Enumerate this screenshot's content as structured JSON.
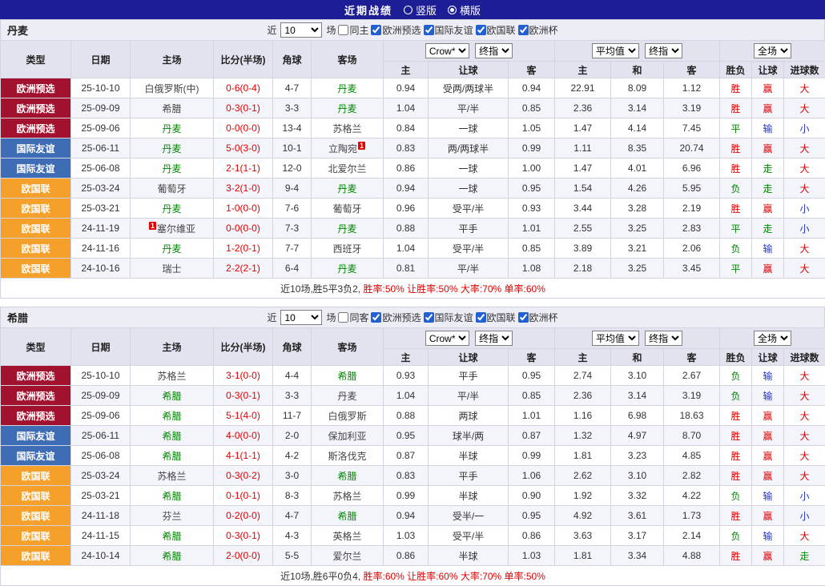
{
  "page": {
    "title": "近期战绩",
    "view_options": [
      {
        "label": "竖版",
        "selected": false
      },
      {
        "label": "横版",
        "selected": true
      }
    ]
  },
  "colors": {
    "titlebar": "#1d1d96",
    "type_colors": {
      "欧洲预选": "#a2112e",
      "国际友谊": "#3e6cb5",
      "欧国联": "#f5a02a"
    },
    "focal_team": "#008800",
    "opponent_team": "#444444",
    "score": "#dd0000",
    "result_map": {
      "胜": "#dd0000",
      "平": "#008800",
      "负": "#008800",
      "赢": "#dd0000",
      "输": "#2233cc",
      "走": "#008800",
      "大": "#dd0000",
      "小": "#2233cc"
    }
  },
  "table": {
    "columns_row1": [
      "类型",
      "日期",
      "主场",
      "比分(半场)",
      "角球",
      "客场"
    ],
    "columns_row2": [
      "主",
      "让球",
      "客",
      "主",
      "和",
      "客",
      "胜负",
      "让球",
      "进球数"
    ],
    "selects": {
      "odds_source": "Crow*",
      "odds_final_1": "终指",
      "avg_source": "平均值",
      "odds_final_2": "终指",
      "scope": "全场"
    }
  },
  "sections": [
    {
      "team": "丹麦",
      "filters": {
        "recent_label": "近",
        "count": "10",
        "games_label": "场",
        "same_venue": {
          "label": "同主",
          "checked": false
        },
        "competitions": [
          {
            "label": "欧洲预选",
            "checked": true
          },
          {
            "label": "国际友谊",
            "checked": true
          },
          {
            "label": "欧国联",
            "checked": true
          },
          {
            "label": "欧洲杯",
            "checked": true
          }
        ]
      },
      "rows": [
        {
          "type": "欧洲预选",
          "date": "25-10-10",
          "home": {
            "name": "白俄罗斯(中)",
            "focal": false
          },
          "score": "0-6(0-4)",
          "corners": "4-7",
          "away": {
            "name": "丹麦",
            "focal": true
          },
          "odds": [
            "0.94",
            "受两/两球半",
            "0.94"
          ],
          "avg": [
            "22.91",
            "8.09",
            "1.12"
          ],
          "results": [
            "胜",
            "赢",
            "大"
          ]
        },
        {
          "type": "欧洲预选",
          "date": "25-09-09",
          "home": {
            "name": "希腊",
            "focal": false
          },
          "score": "0-3(0-1)",
          "corners": "3-3",
          "away": {
            "name": "丹麦",
            "focal": true
          },
          "odds": [
            "1.04",
            "平/半",
            "0.85"
          ],
          "avg": [
            "2.36",
            "3.14",
            "3.19"
          ],
          "results": [
            "胜",
            "赢",
            "大"
          ]
        },
        {
          "type": "欧洲预选",
          "date": "25-09-06",
          "home": {
            "name": "丹麦",
            "focal": true
          },
          "score": "0-0(0-0)",
          "corners": "13-4",
          "away": {
            "name": "苏格兰",
            "focal": false
          },
          "odds": [
            "0.84",
            "一球",
            "1.05"
          ],
          "avg": [
            "1.47",
            "4.14",
            "7.45"
          ],
          "results": [
            "平",
            "输",
            "小"
          ]
        },
        {
          "type": "国际友谊",
          "date": "25-06-11",
          "home": {
            "name": "丹麦",
            "focal": true
          },
          "score": "5-0(3-0)",
          "corners": "10-1",
          "away": {
            "name": "立陶宛",
            "focal": false,
            "badge": "1",
            "badge_pos": "after"
          },
          "odds": [
            "0.83",
            "两/两球半",
            "0.99"
          ],
          "avg": [
            "1.11",
            "8.35",
            "20.74"
          ],
          "results": [
            "胜",
            "赢",
            "大"
          ]
        },
        {
          "type": "国际友谊",
          "date": "25-06-08",
          "home": {
            "name": "丹麦",
            "focal": true
          },
          "score": "2-1(1-1)",
          "corners": "12-0",
          "away": {
            "name": "北爱尔兰",
            "focal": false
          },
          "odds": [
            "0.86",
            "一球",
            "1.00"
          ],
          "avg": [
            "1.47",
            "4.01",
            "6.96"
          ],
          "results": [
            "胜",
            "走",
            "大"
          ]
        },
        {
          "type": "欧国联",
          "date": "25-03-24",
          "home": {
            "name": "葡萄牙",
            "focal": false
          },
          "score": "3-2(1-0)",
          "corners": "9-4",
          "away": {
            "name": "丹麦",
            "focal": true
          },
          "odds": [
            "0.94",
            "一球",
            "0.95"
          ],
          "avg": [
            "1.54",
            "4.26",
            "5.95"
          ],
          "results": [
            "负",
            "走",
            "大"
          ]
        },
        {
          "type": "欧国联",
          "date": "25-03-21",
          "home": {
            "name": "丹麦",
            "focal": true
          },
          "score": "1-0(0-0)",
          "corners": "7-6",
          "away": {
            "name": "葡萄牙",
            "focal": false
          },
          "odds": [
            "0.96",
            "受平/半",
            "0.93"
          ],
          "avg": [
            "3.44",
            "3.28",
            "2.19"
          ],
          "results": [
            "胜",
            "赢",
            "小"
          ]
        },
        {
          "type": "欧国联",
          "date": "24-11-19",
          "home": {
            "name": "塞尔维亚",
            "focal": false,
            "badge": "1",
            "badge_pos": "before"
          },
          "score": "0-0(0-0)",
          "corners": "7-3",
          "away": {
            "name": "丹麦",
            "focal": true
          },
          "odds": [
            "0.88",
            "平手",
            "1.01"
          ],
          "avg": [
            "2.55",
            "3.25",
            "2.83"
          ],
          "results": [
            "平",
            "走",
            "小"
          ]
        },
        {
          "type": "欧国联",
          "date": "24-11-16",
          "home": {
            "name": "丹麦",
            "focal": true
          },
          "score": "1-2(0-1)",
          "corners": "7-7",
          "away": {
            "name": "西班牙",
            "focal": false
          },
          "odds": [
            "1.04",
            "受平/半",
            "0.85"
          ],
          "avg": [
            "3.89",
            "3.21",
            "2.06"
          ],
          "results": [
            "负",
            "输",
            "大"
          ]
        },
        {
          "type": "欧国联",
          "date": "24-10-16",
          "home": {
            "name": "瑞士",
            "focal": false
          },
          "score": "2-2(2-1)",
          "corners": "6-4",
          "away": {
            "name": "丹麦",
            "focal": true
          },
          "odds": [
            "0.81",
            "平/半",
            "1.08"
          ],
          "avg": [
            "2.18",
            "3.25",
            "3.45"
          ],
          "results": [
            "平",
            "赢",
            "大"
          ]
        }
      ],
      "summary": {
        "record": "近10场,胜5平3负2,",
        "stats": "胜率:50% 让胜率:50% 大率:70% 单率:60%"
      }
    },
    {
      "team": "希腊",
      "filters": {
        "recent_label": "近",
        "count": "10",
        "games_label": "场",
        "same_venue": {
          "label": "同客",
          "checked": false
        },
        "competitions": [
          {
            "label": "欧洲预选",
            "checked": true
          },
          {
            "label": "国际友谊",
            "checked": true
          },
          {
            "label": "欧国联",
            "checked": true
          },
          {
            "label": "欧洲杯",
            "checked": true
          }
        ]
      },
      "rows": [
        {
          "type": "欧洲预选",
          "date": "25-10-10",
          "home": {
            "name": "苏格兰",
            "focal": false
          },
          "score": "3-1(0-0)",
          "corners": "4-4",
          "away": {
            "name": "希腊",
            "focal": true
          },
          "odds": [
            "0.93",
            "平手",
            "0.95"
          ],
          "avg": [
            "2.74",
            "3.10",
            "2.67"
          ],
          "results": [
            "负",
            "输",
            "大"
          ]
        },
        {
          "type": "欧洲预选",
          "date": "25-09-09",
          "home": {
            "name": "希腊",
            "focal": true
          },
          "score": "0-3(0-1)",
          "corners": "3-3",
          "away": {
            "name": "丹麦",
            "focal": false
          },
          "odds": [
            "1.04",
            "平/半",
            "0.85"
          ],
          "avg": [
            "2.36",
            "3.14",
            "3.19"
          ],
          "results": [
            "负",
            "输",
            "大"
          ]
        },
        {
          "type": "欧洲预选",
          "date": "25-09-06",
          "home": {
            "name": "希腊",
            "focal": true
          },
          "score": "5-1(4-0)",
          "corners": "11-7",
          "away": {
            "name": "白俄罗斯",
            "focal": false
          },
          "odds": [
            "0.88",
            "两球",
            "1.01"
          ],
          "avg": [
            "1.16",
            "6.98",
            "18.63"
          ],
          "results": [
            "胜",
            "赢",
            "大"
          ]
        },
        {
          "type": "国际友谊",
          "date": "25-06-11",
          "home": {
            "name": "希腊",
            "focal": true
          },
          "score": "4-0(0-0)",
          "corners": "2-0",
          "away": {
            "name": "保加利亚",
            "focal": false
          },
          "odds": [
            "0.95",
            "球半/两",
            "0.87"
          ],
          "avg": [
            "1.32",
            "4.97",
            "8.70"
          ],
          "results": [
            "胜",
            "赢",
            "大"
          ]
        },
        {
          "type": "国际友谊",
          "date": "25-06-08",
          "home": {
            "name": "希腊",
            "focal": true
          },
          "score": "4-1(1-1)",
          "corners": "4-2",
          "away": {
            "name": "斯洛伐克",
            "focal": false
          },
          "odds": [
            "0.87",
            "半球",
            "0.99"
          ],
          "avg": [
            "1.81",
            "3.23",
            "4.85"
          ],
          "results": [
            "胜",
            "赢",
            "大"
          ]
        },
        {
          "type": "欧国联",
          "date": "25-03-24",
          "home": {
            "name": "苏格兰",
            "focal": false
          },
          "score": "0-3(0-2)",
          "corners": "3-0",
          "away": {
            "name": "希腊",
            "focal": true
          },
          "odds": [
            "0.83",
            "平手",
            "1.06"
          ],
          "avg": [
            "2.62",
            "3.10",
            "2.82"
          ],
          "results": [
            "胜",
            "赢",
            "大"
          ]
        },
        {
          "type": "欧国联",
          "date": "25-03-21",
          "home": {
            "name": "希腊",
            "focal": true
          },
          "score": "0-1(0-1)",
          "corners": "8-3",
          "away": {
            "name": "苏格兰",
            "focal": false
          },
          "odds": [
            "0.99",
            "半球",
            "0.90"
          ],
          "avg": [
            "1.92",
            "3.32",
            "4.22"
          ],
          "results": [
            "负",
            "输",
            "小"
          ]
        },
        {
          "type": "欧国联",
          "date": "24-11-18",
          "home": {
            "name": "芬兰",
            "focal": false
          },
          "score": "0-2(0-0)",
          "corners": "4-7",
          "away": {
            "name": "希腊",
            "focal": true
          },
          "odds": [
            "0.94",
            "受半/一",
            "0.95"
          ],
          "avg": [
            "4.92",
            "3.61",
            "1.73"
          ],
          "results": [
            "胜",
            "赢",
            "小"
          ]
        },
        {
          "type": "欧国联",
          "date": "24-11-15",
          "home": {
            "name": "希腊",
            "focal": true
          },
          "score": "0-3(0-1)",
          "corners": "4-3",
          "away": {
            "name": "英格兰",
            "focal": false
          },
          "odds": [
            "1.03",
            "受平/半",
            "0.86"
          ],
          "avg": [
            "3.63",
            "3.17",
            "2.14"
          ],
          "results": [
            "负",
            "输",
            "大"
          ]
        },
        {
          "type": "欧国联",
          "date": "24-10-14",
          "home": {
            "name": "希腊",
            "focal": true
          },
          "score": "2-0(0-0)",
          "corners": "5-5",
          "away": {
            "name": "爱尔兰",
            "focal": false
          },
          "odds": [
            "0.86",
            "半球",
            "1.03"
          ],
          "avg": [
            "1.81",
            "3.34",
            "4.88"
          ],
          "results": [
            "胜",
            "赢",
            "走"
          ]
        }
      ],
      "summary": {
        "record": "近10场,胜6平0负4,",
        "stats": "胜率:60% 让胜率:60% 大率:70% 单率:50%"
      }
    }
  ]
}
